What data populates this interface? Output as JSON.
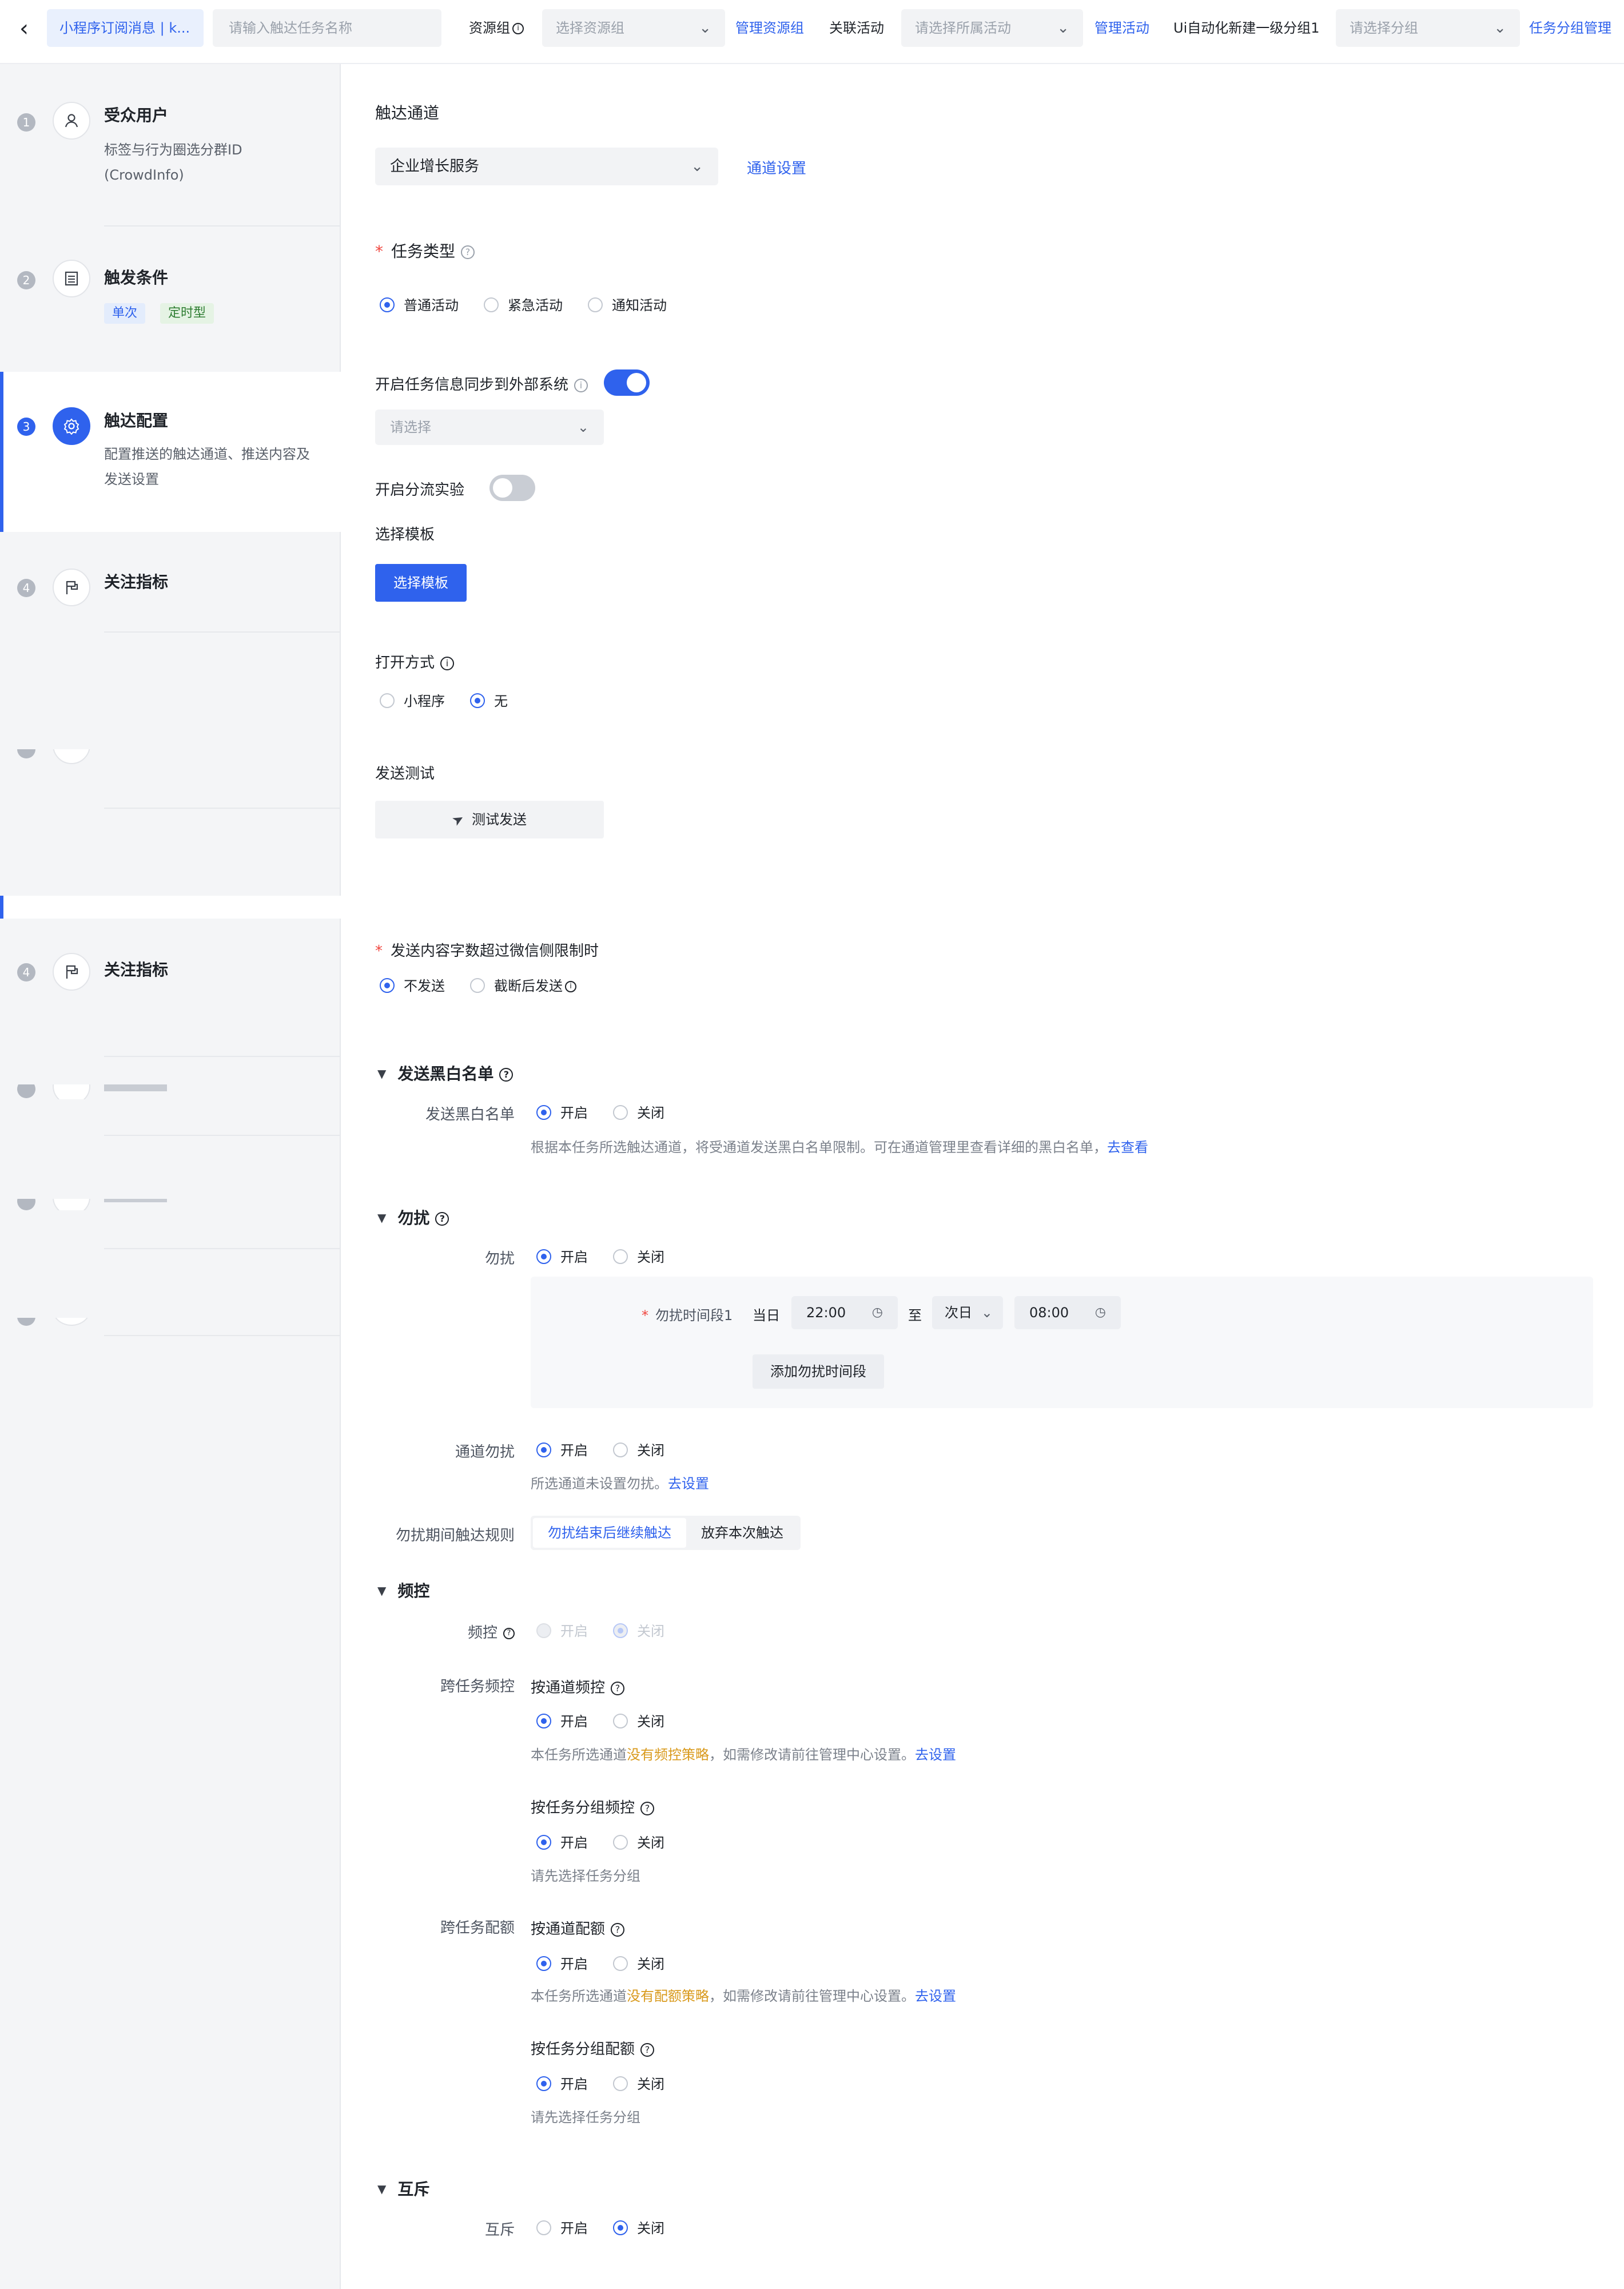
{
  "topbar": {
    "back_icon": "chevron-left-icon",
    "task_tag": "小程序订阅消息 | k...",
    "task_name_placeholder": "请输入触达任务名称",
    "resource_group_label": "资源组",
    "resource_group_placeholder": "选择资源组",
    "manage_resource_group": "管理资源组",
    "related_activity_label": "关联活动",
    "activity_placeholder": "请选择所属活动",
    "manage_activity": "管理活动",
    "group_label": "Ui自动化新建一级分组1",
    "group_placeholder": "请选择分组",
    "manage_task_group": "任务分组管理"
  },
  "sidebar": {
    "steps": [
      {
        "num": "1",
        "icon": "user-icon",
        "title": "受众用户",
        "desc": "标签与行为圈选分群ID (CrowdInfo)"
      },
      {
        "num": "2",
        "icon": "list-icon",
        "title": "触发条件",
        "badges": [
          "单次",
          "定时型"
        ]
      },
      {
        "num": "3",
        "icon": "gear-icon",
        "title": "触达配置",
        "desc": "配置推送的触达通道、推送内容及发送设置"
      },
      {
        "num": "4",
        "icon": "flag-icon",
        "title": "关注指标"
      },
      {
        "num": "4",
        "icon": "flag-icon",
        "title": "关注指标"
      }
    ]
  },
  "main": {
    "channel": {
      "label": "触达通道",
      "value": "企业增长服务",
      "settings_link": "通道设置"
    },
    "task_type": {
      "label": "任务类型",
      "options": [
        "普通活动",
        "紧急活动",
        "通知活动"
      ],
      "selected": "普通活动"
    },
    "sync": {
      "label": "开启任务信息同步到外部系统",
      "enabled": true,
      "select_placeholder": "请选择"
    },
    "ab_test": {
      "label": "开启分流实验",
      "enabled": false
    },
    "template": {
      "label": "选择模板",
      "button": "选择模板"
    },
    "open_mode": {
      "label": "打开方式",
      "options": [
        "小程序",
        "无"
      ],
      "selected": "无"
    },
    "send_test": {
      "label": "发送测试",
      "button": "测试发送"
    },
    "overflow": {
      "label": "发送内容字数超过微信侧限制时",
      "options": [
        "不发送",
        "截断后发送"
      ],
      "selected": "不发送"
    },
    "blacklist": {
      "section": "发送黑白名单",
      "label": "发送黑白名单",
      "options": [
        "开启",
        "关闭"
      ],
      "selected": "开启",
      "note": "根据本任务所选触达通道，将受通道发送黑白名单限制。可在通道管理里查看详细的黑白名单，",
      "note_link": "去查看"
    },
    "dnd": {
      "section": "勿扰",
      "label": "勿扰",
      "options": [
        "开启",
        "关闭"
      ],
      "selected": "开启",
      "period_label": "勿扰时间段1",
      "day_start": "当日",
      "time_start": "22:00",
      "to": "至",
      "day_end": "次日",
      "time_end": "08:00",
      "add_period": "添加勿扰时间段",
      "channel_label": "通道勿扰",
      "channel_options": [
        "开启",
        "关闭"
      ],
      "channel_selected": "开启",
      "channel_note": "所选通道未设置勿扰。",
      "channel_note_link": "去设置",
      "rule_label": "勿扰期间触达规则",
      "rule_options": [
        "勿扰结束后继续触达",
        "放弃本次触达"
      ],
      "rule_selected": "勿扰结束后继续触达"
    },
    "freq": {
      "section": "频控",
      "label": "频控",
      "options": [
        "开启",
        "关闭"
      ],
      "selected": "关闭",
      "cross_label": "跨任务频控",
      "by_channel": "按通道频控",
      "by_channel_options": [
        "开启",
        "关闭"
      ],
      "by_channel_selected": "开启",
      "by_channel_note_a": "本任务所选通道",
      "by_channel_note_hl": "没有频控策略",
      "by_channel_note_b": "，如需修改请前往管理中心设置。",
      "by_channel_note_link": "去设置",
      "by_group": "按任务分组频控",
      "by_group_options": [
        "开启",
        "关闭"
      ],
      "by_group_selected": "开启",
      "by_group_note": "请先选择任务分组"
    },
    "quota": {
      "label": "跨任务配额",
      "by_channel": "按通道配额",
      "by_channel_options": [
        "开启",
        "关闭"
      ],
      "by_channel_selected": "开启",
      "by_channel_note_a": "本任务所选通道",
      "by_channel_note_hl": "没有配额策略",
      "by_channel_note_b": "，如需修改请前往管理中心设置。",
      "by_channel_note_link": "去设置",
      "by_group": "按任务分组配额",
      "by_group_options": [
        "开启",
        "关闭"
      ],
      "by_group_selected": "开启",
      "by_group_note": "请先选择任务分组"
    },
    "mutex": {
      "section": "互斥",
      "label": "互斥",
      "options": [
        "开启",
        "关闭"
      ],
      "selected": "关闭"
    }
  }
}
